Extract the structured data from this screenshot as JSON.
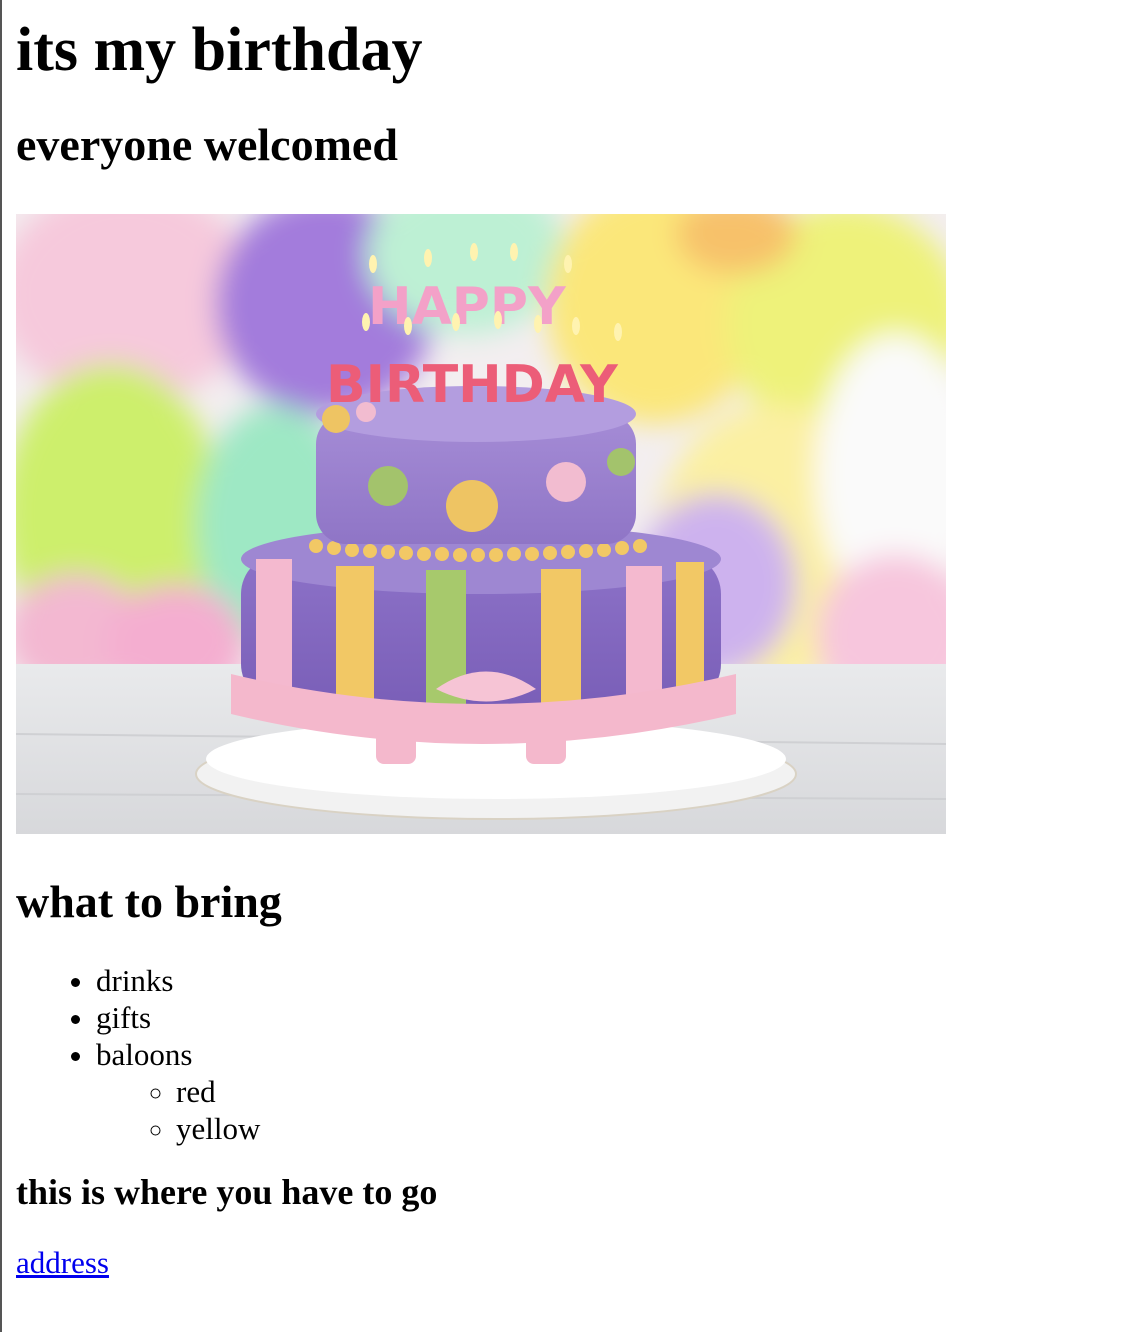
{
  "page": {
    "title": "its my birthday",
    "subtitle": "everyone welcomed",
    "image": {
      "cake_lettering_top": "HAPPY",
      "cake_lettering_bottom": "BIRTHDAY"
    },
    "bring_heading": "what to bring",
    "bring_items": [
      {
        "label": "drinks"
      },
      {
        "label": "gifts"
      },
      {
        "label": "baloons",
        "sub_items": [
          "red",
          "yellow"
        ]
      }
    ],
    "where_heading": "this is where you have to go",
    "address_link": "address"
  },
  "colors": {
    "link": "#0000ee",
    "text": "#000000",
    "background": "#ffffff"
  }
}
